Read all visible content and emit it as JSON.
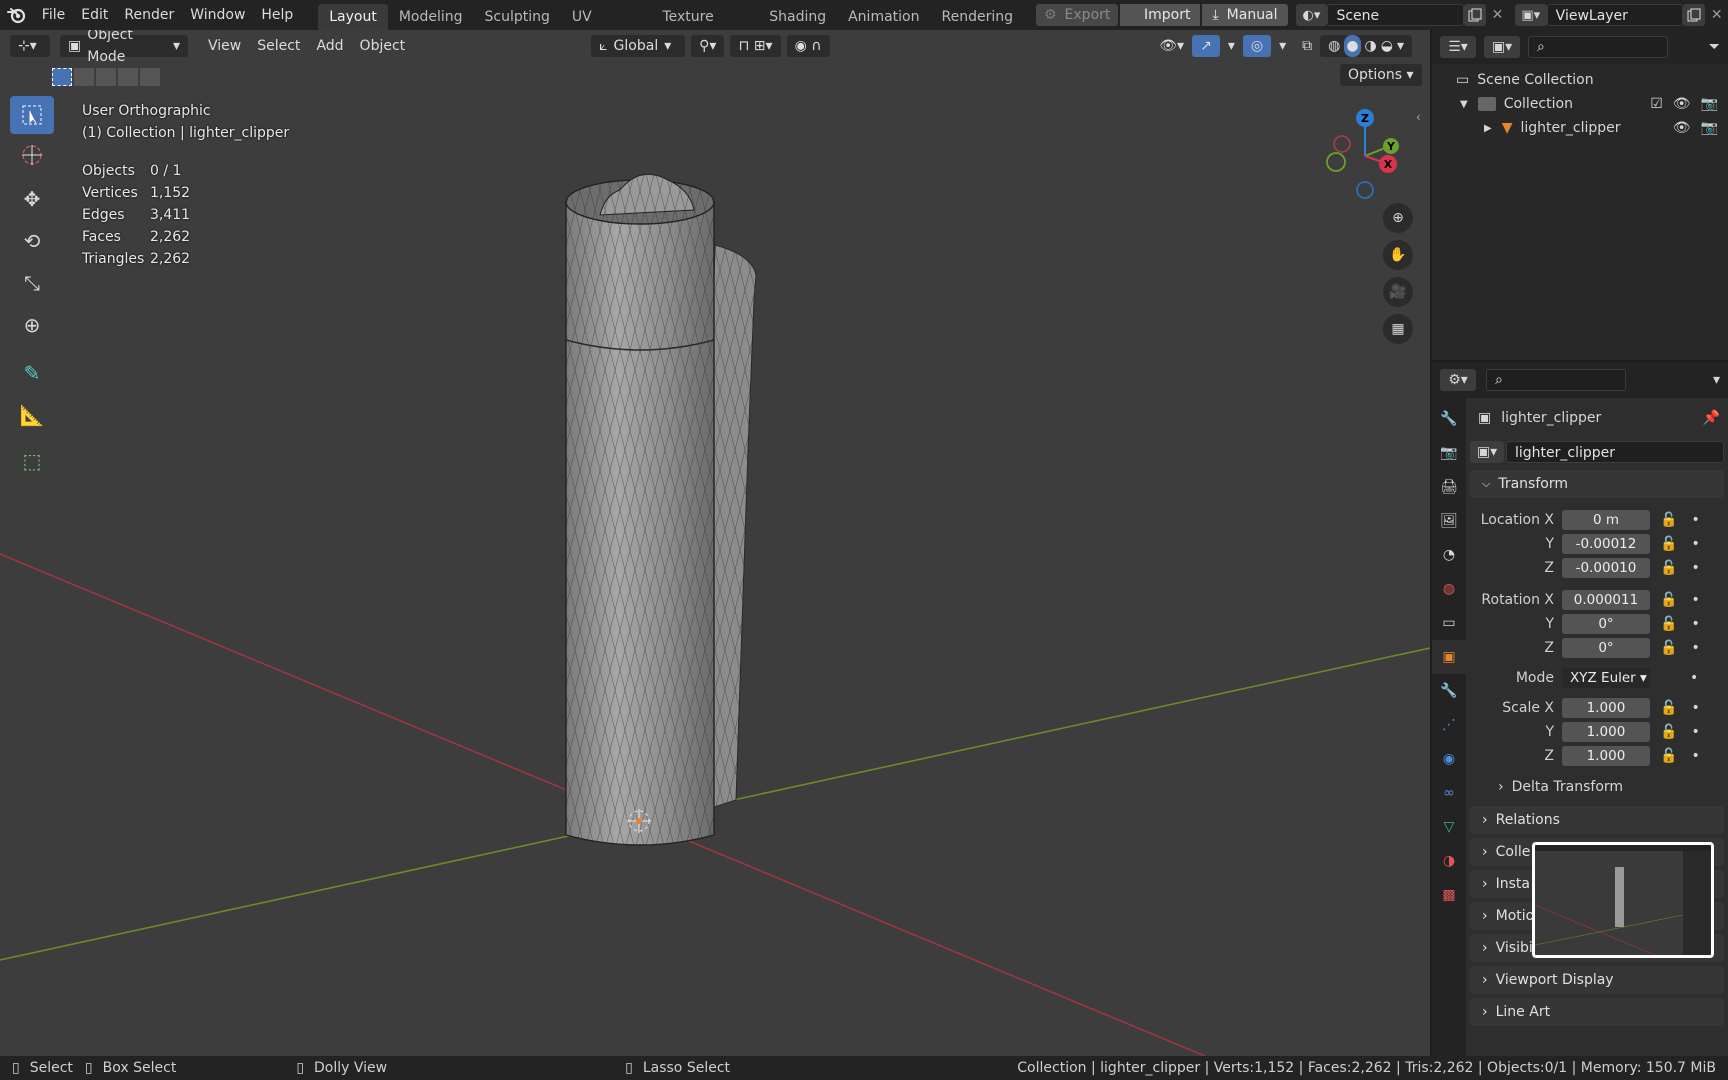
{
  "topbar": {
    "menus": [
      "File",
      "Edit",
      "Render",
      "Window",
      "Help"
    ],
    "workspaces": [
      "Layout",
      "Modeling",
      "Sculpting",
      "UV Editing",
      "Texture Paint",
      "Shading",
      "Animation",
      "Rendering"
    ],
    "active_workspace": "Layout",
    "export_label": "Export",
    "import_label": "Import",
    "manual_label": "Manual",
    "scene": "Scene",
    "view_layer": "ViewLayer"
  },
  "viewport": {
    "mode": "Object Mode",
    "menus": [
      "View",
      "Select",
      "Add",
      "Object"
    ],
    "orientation": "Global",
    "options_label": "Options",
    "view_name": "User Orthographic",
    "collection_line": "(1) Collection | lighter_clipper",
    "stats": [
      {
        "label": "Objects",
        "value": "0 / 1"
      },
      {
        "label": "Vertices",
        "value": "1,152"
      },
      {
        "label": "Edges",
        "value": "3,411"
      },
      {
        "label": "Faces",
        "value": "2,262"
      },
      {
        "label": "Triangles",
        "value": "2,262"
      }
    ],
    "gizmo": {
      "x": "X",
      "y": "Y",
      "z": "Z"
    }
  },
  "outliner": {
    "scene_collection": "Scene Collection",
    "collection": "Collection",
    "object": "lighter_clipper"
  },
  "properties": {
    "object_name": "lighter_clipper",
    "data_name": "lighter_clipper",
    "transform_title": "Transform",
    "location_label": "Location X",
    "location": [
      "0 m",
      "-0.00012",
      "-0.00010"
    ],
    "rotation_label": "Rotation X",
    "rotation": [
      "0.000011",
      "0°",
      "0°"
    ],
    "axis_y": "Y",
    "axis_z": "Z",
    "mode_label": "Mode",
    "mode_value": "XYZ Euler",
    "scale_label": "Scale X",
    "scale": [
      "1.000",
      "1.000",
      "1.000"
    ],
    "delta_transform": "Delta Transform",
    "panels": [
      "Relations",
      "Colle",
      "Insta",
      "Motio",
      "Visibility",
      "Viewport Display",
      "Line Art"
    ]
  },
  "status": {
    "select": "Select",
    "box_select": "Box Select",
    "dolly_view": "Dolly View",
    "lasso_select": "Lasso Select",
    "info": "Collection | lighter_clipper | Verts:1,152 | Faces:2,262 | Tris:2,262 | Objects:0/1 | Memory: 150.7 MiB"
  },
  "colors": {
    "accent": "#4772b3",
    "x_axis": "#9e3443",
    "y_axis": "#6b8a2a",
    "object_orange": "#e8842a"
  }
}
